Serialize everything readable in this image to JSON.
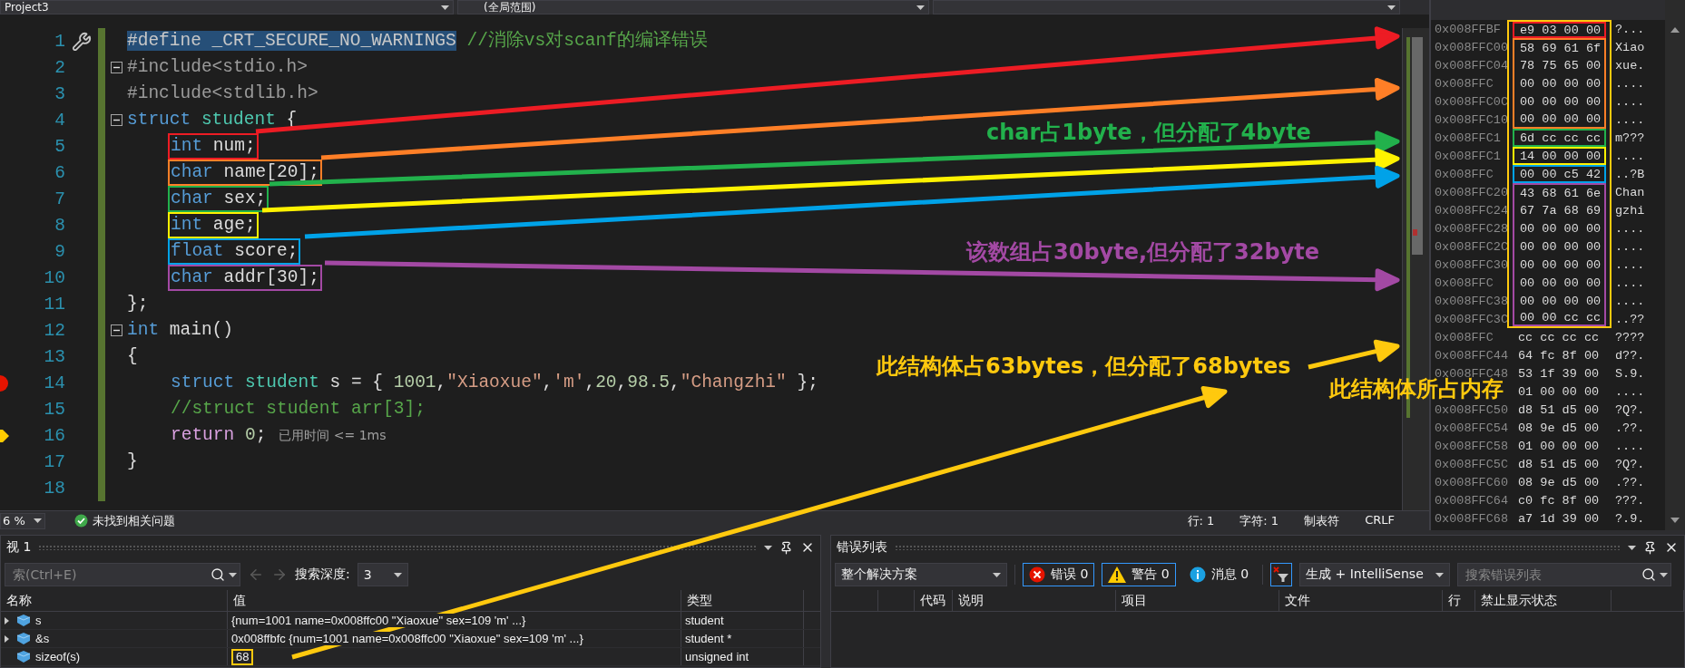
{
  "nav_bar": {
    "project": "Project3",
    "scope": "(全局范围)"
  },
  "editor": {
    "lines": [
      {
        "number": "1",
        "kind": "top",
        "fold": false,
        "quick_action": true,
        "breakpoint": false,
        "current": false,
        "tokens": [
          {
            "kind": "selection",
            "text": "#define _CRT_SECURE_NO_WARNINGS"
          },
          {
            "kind": "comment",
            "text": " //消除vs对scanf的编译错误"
          }
        ]
      },
      {
        "number": "2",
        "kind": "top",
        "fold": true,
        "quick_action": false,
        "breakpoint": false,
        "current": false,
        "tokens": [
          {
            "kind": "preproc",
            "text": "#include<stdio.h>"
          }
        ]
      },
      {
        "number": "3",
        "kind": "top",
        "fold": false,
        "quick_action": false,
        "breakpoint": false,
        "current": false,
        "tokens": [
          {
            "kind": "preproc",
            "text": "#include<stdlib.h>"
          }
        ]
      },
      {
        "number": "4",
        "kind": "top",
        "fold": true,
        "quick_action": false,
        "breakpoint": false,
        "current": false,
        "tokens": [
          {
            "kind": "keyword",
            "text": "struct"
          },
          {
            "kind": "type",
            "text": " student"
          },
          {
            "kind": "plain",
            "text": " {"
          }
        ]
      },
      {
        "number": "5",
        "kind": "indented",
        "fold": false,
        "quick_action": false,
        "breakpoint": false,
        "current": false,
        "color": "#ed1c24",
        "tokens": [
          {
            "kind": "keyword",
            "text": "int"
          },
          {
            "kind": "plain",
            "text": " num;"
          }
        ]
      },
      {
        "number": "6",
        "kind": "indented",
        "fold": false,
        "quick_action": false,
        "breakpoint": false,
        "current": false,
        "color": "#ff7f27",
        "tokens": [
          {
            "kind": "keyword",
            "text": "char"
          },
          {
            "kind": "plain",
            "text": " name[20];"
          }
        ]
      },
      {
        "number": "7",
        "kind": "indented",
        "fold": false,
        "quick_action": false,
        "breakpoint": false,
        "current": false,
        "color": "#22b14c",
        "tokens": [
          {
            "kind": "keyword",
            "text": "char"
          },
          {
            "kind": "plain",
            "text": " sex;"
          }
        ]
      },
      {
        "number": "8",
        "kind": "indented",
        "fold": false,
        "quick_action": false,
        "breakpoint": false,
        "current": false,
        "color": "#fff200",
        "tokens": [
          {
            "kind": "keyword",
            "text": "int"
          },
          {
            "kind": "plain",
            "text": " age;"
          }
        ]
      },
      {
        "number": "9",
        "kind": "indented",
        "fold": false,
        "quick_action": false,
        "breakpoint": false,
        "current": false,
        "color": "#00a2e8",
        "tokens": [
          {
            "kind": "keyword",
            "text": "float"
          },
          {
            "kind": "plain",
            "text": " score;"
          }
        ]
      },
      {
        "number": "10",
        "kind": "indented",
        "fold": false,
        "quick_action": false,
        "breakpoint": false,
        "current": false,
        "color": "#a349a4",
        "tokens": [
          {
            "kind": "keyword",
            "text": "char"
          },
          {
            "kind": "plain",
            "text": " addr[30];"
          }
        ]
      },
      {
        "number": "11",
        "kind": "top",
        "fold": false,
        "quick_action": false,
        "breakpoint": false,
        "current": false,
        "tokens": [
          {
            "kind": "plain",
            "text": "};"
          }
        ]
      },
      {
        "number": "12",
        "kind": "top",
        "fold": true,
        "quick_action": false,
        "breakpoint": false,
        "current": false,
        "tokens": [
          {
            "kind": "keyword",
            "text": "int"
          },
          {
            "kind": "plain",
            "text": " main()"
          }
        ]
      },
      {
        "number": "13",
        "kind": "top",
        "fold": false,
        "quick_action": false,
        "breakpoint": false,
        "current": false,
        "tokens": [
          {
            "kind": "plain",
            "text": "{"
          }
        ]
      },
      {
        "number": "14",
        "kind": "indented",
        "fold": false,
        "quick_action": false,
        "breakpoint": true,
        "current": false,
        "tokens": [
          {
            "kind": "keyword",
            "text": "struct"
          },
          {
            "kind": "type",
            "text": " student"
          },
          {
            "kind": "plain",
            "text": " s = { "
          },
          {
            "kind": "number",
            "text": "1001"
          },
          {
            "kind": "plain",
            "text": ","
          },
          {
            "kind": "string",
            "text": "\"Xiaoxue\""
          },
          {
            "kind": "plain",
            "text": ","
          },
          {
            "kind": "string",
            "text": "'m'"
          },
          {
            "kind": "plain",
            "text": ","
          },
          {
            "kind": "number",
            "text": "20"
          },
          {
            "kind": "plain",
            "text": ","
          },
          {
            "kind": "number",
            "text": "98.5"
          },
          {
            "kind": "plain",
            "text": ","
          },
          {
            "kind": "string",
            "text": "\"Changzhi\""
          },
          {
            "kind": "plain",
            "text": " };"
          }
        ]
      },
      {
        "number": "15",
        "kind": "indented",
        "fold": false,
        "quick_action": false,
        "breakpoint": false,
        "current": false,
        "tokens": [
          {
            "kind": "comment",
            "text": "//struct student arr[3];"
          }
        ]
      },
      {
        "number": "16",
        "kind": "indented",
        "fold": false,
        "quick_action": false,
        "breakpoint": false,
        "current": true,
        "tokens": [
          {
            "kind": "control",
            "text": "return"
          },
          {
            "kind": "number",
            "text": " 0"
          },
          {
            "kind": "plain",
            "text": ";"
          },
          {
            "kind": "hint",
            "text": "已用时间 <= 1ms"
          }
        ]
      },
      {
        "number": "17",
        "kind": "top",
        "fold": false,
        "quick_action": false,
        "breakpoint": false,
        "current": false,
        "tokens": [
          {
            "kind": "plain",
            "text": "}"
          }
        ]
      },
      {
        "number": "18",
        "kind": "top",
        "fold": false,
        "quick_action": false,
        "breakpoint": false,
        "current": false
      }
    ]
  },
  "status_bar": {
    "zoom": "6 %",
    "issues": "未找到相关问题",
    "line": "行: 1",
    "column": "字符: 1",
    "indent": "制表符",
    "line_ending": "CRLF"
  },
  "memory": {
    "rows": [
      {
        "address": "0x008FFBF",
        "bytes": "e9 03 00 00",
        "chars": "?...",
        "in_struct": true,
        "color": "#ed1c24"
      },
      {
        "address": "0x008FFC00",
        "bytes": "58 69 61 6f",
        "chars": "Xiao",
        "in_struct": true,
        "color": "#ff7f27"
      },
      {
        "address": "0x008FFC04",
        "bytes": "78 75 65 00",
        "chars": "xue.",
        "in_struct": true,
        "color": "#ff7f27"
      },
      {
        "address": "0x008FFC",
        "bytes": "00 00 00 00",
        "chars": "....",
        "in_struct": true,
        "color": "#ff7f27"
      },
      {
        "address": "0x008FFC0C",
        "bytes": "00 00 00 00",
        "chars": "....",
        "in_struct": true,
        "color": "#ff7f27"
      },
      {
        "address": "0x008FFC10",
        "bytes": "00 00 00 00",
        "chars": "....",
        "in_struct": true,
        "color": "#ff7f27"
      },
      {
        "address": "0x008FFC1",
        "bytes": "6d cc cc cc",
        "chars": "m???",
        "in_struct": true,
        "color": "#22b14c"
      },
      {
        "address": "0x008FFC1",
        "bytes": "14 00 00 00",
        "chars": "....",
        "in_struct": true,
        "color": "#fff200"
      },
      {
        "address": "0x008FFC",
        "bytes": "00 00 c5 42",
        "chars": "..?B",
        "in_struct": true,
        "color": "#00a2e8"
      },
      {
        "address": "0x008FFC20",
        "bytes": "43 68 61 6e",
        "chars": "Chan",
        "in_struct": true,
        "color": "#a349a4"
      },
      {
        "address": "0x008FFC24",
        "bytes": "67 7a 68 69",
        "chars": "gzhi",
        "in_struct": true,
        "color": "#a349a4"
      },
      {
        "address": "0x008FFC28",
        "bytes": "00 00 00 00",
        "chars": "....",
        "in_struct": true,
        "color": "#a349a4"
      },
      {
        "address": "0x008FFC2C",
        "bytes": "00 00 00 00",
        "chars": "....",
        "in_struct": true,
        "color": "#a349a4"
      },
      {
        "address": "0x008FFC30",
        "bytes": "00 00 00 00",
        "chars": "....",
        "in_struct": true,
        "color": "#a349a4"
      },
      {
        "address": "0x008FFC",
        "bytes": "00 00 00 00",
        "chars": "....",
        "in_struct": true,
        "color": "#a349a4"
      },
      {
        "address": "0x008FFC38",
        "bytes": "00 00 00 00",
        "chars": "....",
        "in_struct": true,
        "color": "#a349a4"
      },
      {
        "address": "0x008FFC3C",
        "bytes": "00 00 cc cc",
        "chars": "..??",
        "in_struct": true,
        "color": "#a349a4"
      },
      {
        "address": "0x008FFC",
        "bytes": "cc cc cc cc",
        "chars": "????",
        "in_struct": false
      },
      {
        "address": "0x008FFC44",
        "bytes": "64 fc 8f 00",
        "chars": "d??.",
        "in_struct": false
      },
      {
        "address": "0x008FFC48",
        "bytes": "53 1f 39 00",
        "chars": "S.9.",
        "in_struct": false
      },
      {
        "bytes": "01 00 00 00",
        "chars": "....",
        "in_struct": false
      },
      {
        "address": "0x008FFC50",
        "bytes": "d8 51 d5 00",
        "chars": "?Q?.",
        "in_struct": false
      },
      {
        "address": "0x008FFC54",
        "bytes": "08 9e d5 00",
        "chars": ".??.",
        "in_struct": false
      },
      {
        "address": "0x008FFC58",
        "bytes": "01 00 00 00",
        "chars": "....",
        "in_struct": false
      },
      {
        "address": "0x008FFC5C",
        "bytes": "d8 51 d5 00",
        "chars": "?Q?.",
        "in_struct": false
      },
      {
        "address": "0x008FFC60",
        "bytes": "08 9e d5 00",
        "chars": ".??.",
        "in_struct": false
      },
      {
        "address": "0x008FFC64",
        "bytes": "c0 fc 8f 00",
        "chars": "???.",
        "in_struct": false
      },
      {
        "address": "0x008FFC68",
        "bytes": "a7 1d 39 00",
        "chars": "?.9.",
        "in_struct": false
      }
    ]
  },
  "watch": {
    "title": "视 1",
    "search_placeholder": "索(Ctrl+E)",
    "depth_label": "搜索深度:",
    "depth": "3",
    "columns": [
      "名称",
      "值",
      "类型"
    ],
    "rows": [
      {
        "name": "s",
        "value": "{num=1001 name=0x008ffc00 \"Xiaoxue\" sex=109 'm' ...}",
        "type": "student",
        "expandable": true
      },
      {
        "name": "&s",
        "value": "0x008ffbfc {num=1001 name=0x008ffc00 \"Xiaoxue\" sex=109 'm' ...}",
        "type": "student *",
        "expandable": true
      },
      {
        "name": "sizeof(s)",
        "value": "68",
        "type": "unsigned int",
        "expandable": false,
        "color": "#ffc90e"
      }
    ]
  },
  "error_list": {
    "title": "错误列表",
    "scope": "整个解决方案",
    "filters": [
      {
        "kind": "error",
        "label": "错误 0",
        "selected": true
      },
      {
        "kind": "warning",
        "label": "警告 0",
        "selected": true
      },
      {
        "kind": "info",
        "label": "消息 0",
        "selected": false
      }
    ],
    "filter_button": {
      "selected": true
    },
    "source": "生成 + IntelliSense",
    "search_placeholder": "搜索错误列表",
    "columns": [
      "代码",
      "说明",
      "项目",
      "文件",
      "行",
      "禁止显示状态"
    ]
  },
  "annotations": {
    "notes": [
      {
        "text": "char占1byte，但分配了4byte",
        "color": "#22b14c"
      },
      {
        "text": "该数组占30byte,但分配了32byte",
        "color": "#a349a4"
      },
      {
        "text": "此结构体占63bytes，但分配了68bytes",
        "color": "#ffc90e"
      },
      {
        "text": "此结构体所占内存",
        "color": "#ffc90e"
      }
    ],
    "arrows": [
      {
        "color": "#ed1c24"
      },
      {
        "color": "#ff7f27"
      },
      {
        "color": "#22b14c"
      },
      {
        "color": "#fff200"
      },
      {
        "color": "#00a2e8"
      },
      {
        "color": "#a349a4"
      },
      {
        "color": "#ffc90e"
      },
      {
        "color": "#ffc90e"
      }
    ]
  }
}
